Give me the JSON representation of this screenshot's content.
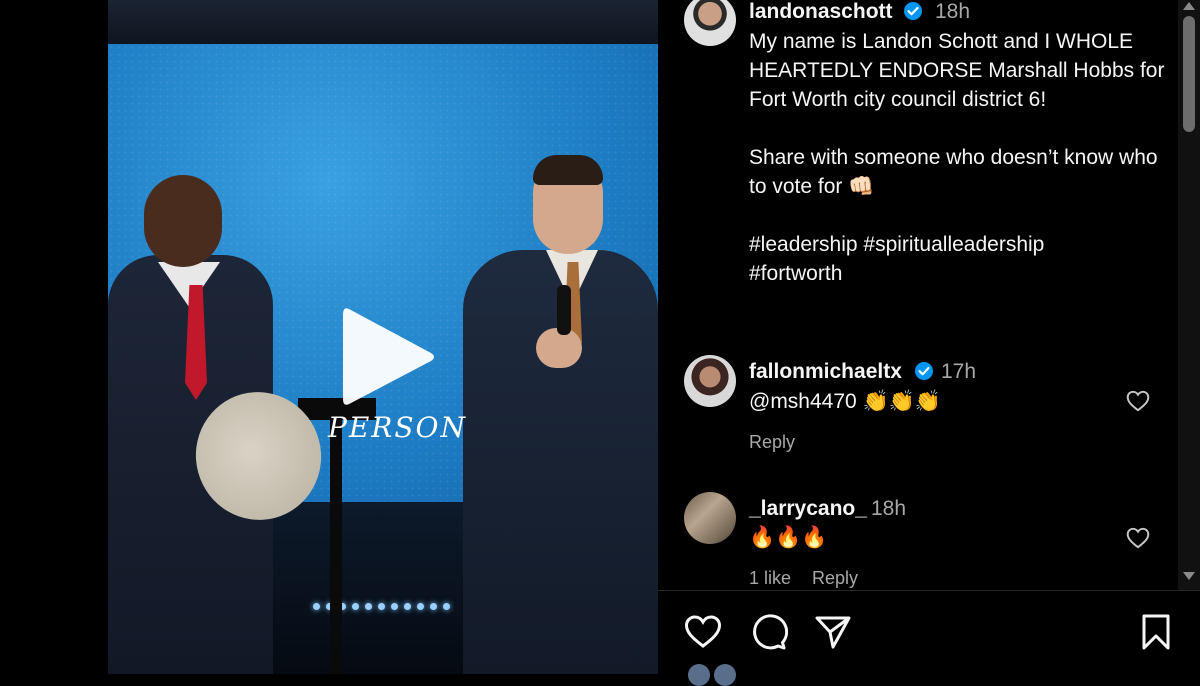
{
  "post": {
    "author": "landonaschott",
    "time": "18h",
    "caption": "My name is Landon Schott and I WHOLE HEARTEDLY ENDORSE Marshall Hobbs for Fort Worth city council district 6!\n\nShare with someone who doesn’t know who to vote for 👊🏻\n\n#leadership #spiritualleadership\n#fortworth",
    "video_caption": "PERSON"
  },
  "comments": [
    {
      "user": "fallonmichaeltx",
      "verified": true,
      "time": "17h",
      "text": "@msh4470 👏👏👏",
      "reply": "Reply"
    },
    {
      "user": "_larrycano_",
      "verified": false,
      "time": "18h",
      "text": "🔥🔥🔥",
      "likes": "1 like",
      "reply": "Reply"
    }
  ],
  "icons": {
    "like": "heart-icon",
    "comment": "comment-icon",
    "share": "share-icon",
    "save": "bookmark-icon",
    "play": "play-icon",
    "verified": "verified-badge-icon"
  },
  "colors": {
    "background": "#000000",
    "verified": "#0095f6",
    "secondary_text": "#a8a8a8"
  }
}
